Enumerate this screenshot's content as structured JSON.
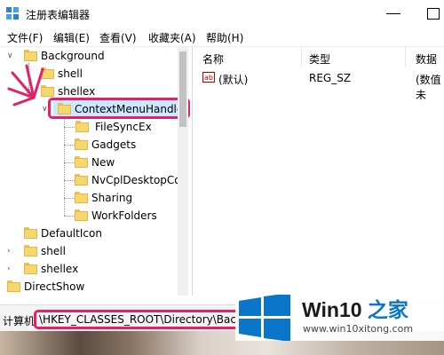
{
  "window": {
    "title": "注册表编辑器"
  },
  "menu": [
    "文件(F)",
    "编辑(E)",
    "查看(V)",
    "收藏夹(A)",
    "帮助(H)"
  ],
  "tree": {
    "items": [
      "Background",
      "shell",
      "shellex",
      "ContextMenuHandle",
      "FileSyncEx",
      "Gadgets",
      "New",
      "NvCplDesktopCo",
      "Sharing",
      "WorkFolders",
      "DefaultIcon",
      "shell",
      "shellex",
      "DirectShow"
    ],
    "selected": "ContextMenuHandle"
  },
  "list": {
    "columns": [
      "名称",
      "类型",
      "数据"
    ],
    "rows": [
      {
        "name": "(默认)",
        "type": "REG_SZ",
        "data": "(数值未"
      }
    ],
    "icon": "ab"
  },
  "status": {
    "prefix": "计算机",
    "path": "\\HKEY_CLASSES_ROOT\\Directory\\Backg"
  },
  "watermark": {
    "title_main": "Win10",
    "title_accent": "之家",
    "url": "www.win10xitong.com"
  },
  "colors": {
    "highlight": "#e4206a",
    "selection": "#cce8ff",
    "brand": "#0a76c9"
  }
}
